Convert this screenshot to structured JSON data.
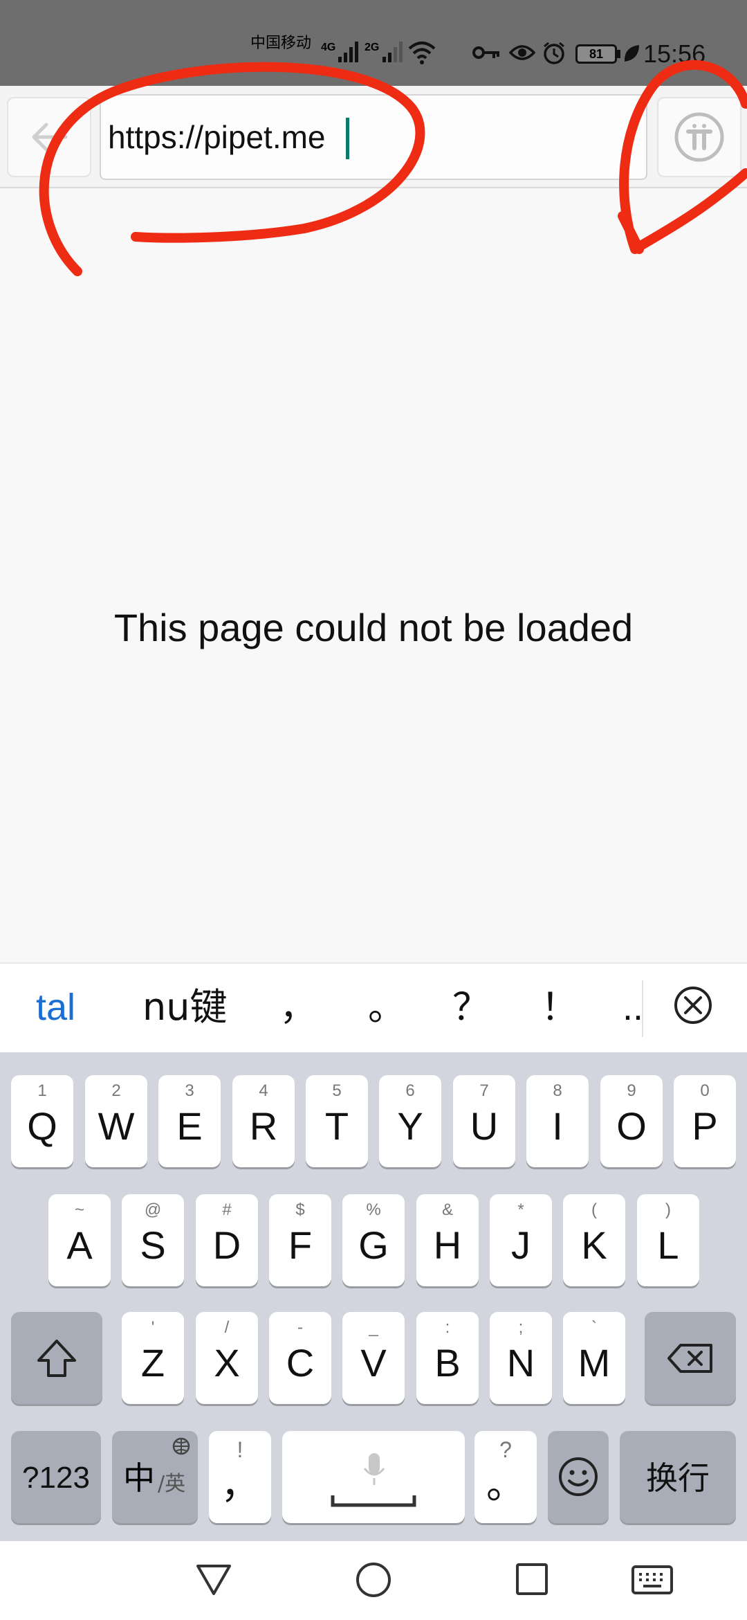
{
  "status_bar": {
    "carrier_line1": "中国移动",
    "carrier_line2": "中国移动",
    "network_1": "4G",
    "network_2": "2G",
    "battery_level": "81",
    "time": "15:56",
    "icons": [
      "signal-icon",
      "wifi-icon",
      "key-icon",
      "eye-icon",
      "alarm-icon",
      "battery-icon",
      "leaf-icon"
    ]
  },
  "toolbar": {
    "url_value": "https://pipet.me",
    "back_icon": "back-arrow-icon",
    "pi_icon": "pi-logo-icon"
  },
  "page": {
    "message": "This page could not be loaded"
  },
  "candidates": [
    "tal",
    "nu键",
    "，",
    "。",
    "？",
    "！",
    "..",
    "close"
  ],
  "keyboard": {
    "row1": [
      {
        "hint": "1",
        "key": "Q"
      },
      {
        "hint": "2",
        "key": "W"
      },
      {
        "hint": "3",
        "key": "E"
      },
      {
        "hint": "4",
        "key": "R"
      },
      {
        "hint": "5",
        "key": "T"
      },
      {
        "hint": "6",
        "key": "Y"
      },
      {
        "hint": "7",
        "key": "U"
      },
      {
        "hint": "8",
        "key": "I"
      },
      {
        "hint": "9",
        "key": "O"
      },
      {
        "hint": "0",
        "key": "P"
      }
    ],
    "row2": [
      {
        "hint": "~",
        "key": "A"
      },
      {
        "hint": "@",
        "key": "S"
      },
      {
        "hint": "#",
        "key": "D"
      },
      {
        "hint": "$",
        "key": "F"
      },
      {
        "hint": "%",
        "key": "G"
      },
      {
        "hint": "&",
        "key": "H"
      },
      {
        "hint": "*",
        "key": "J"
      },
      {
        "hint": "(",
        "key": "K"
      },
      {
        "hint": ")",
        "key": "L"
      }
    ],
    "row3": [
      {
        "hint": "'",
        "key": "Z"
      },
      {
        "hint": "/",
        "key": "X"
      },
      {
        "hint": "-",
        "key": "C"
      },
      {
        "hint": "_",
        "key": "V"
      },
      {
        "hint": ":",
        "key": "B"
      },
      {
        "hint": ";",
        "key": "N"
      },
      {
        "hint": "`",
        "key": "M"
      }
    ],
    "row4": {
      "symbols_label": "?123",
      "lang_main": "中",
      "lang_sub": "/英",
      "comma_hint": "!",
      "comma_key": "，",
      "period_hint": "?",
      "period_key": "。",
      "enter_label": "换行"
    }
  },
  "nav_bar": {
    "icons": [
      "back-triangle-icon",
      "home-circle-icon",
      "recents-square-icon",
      "keyboard-hide-icon"
    ]
  }
}
